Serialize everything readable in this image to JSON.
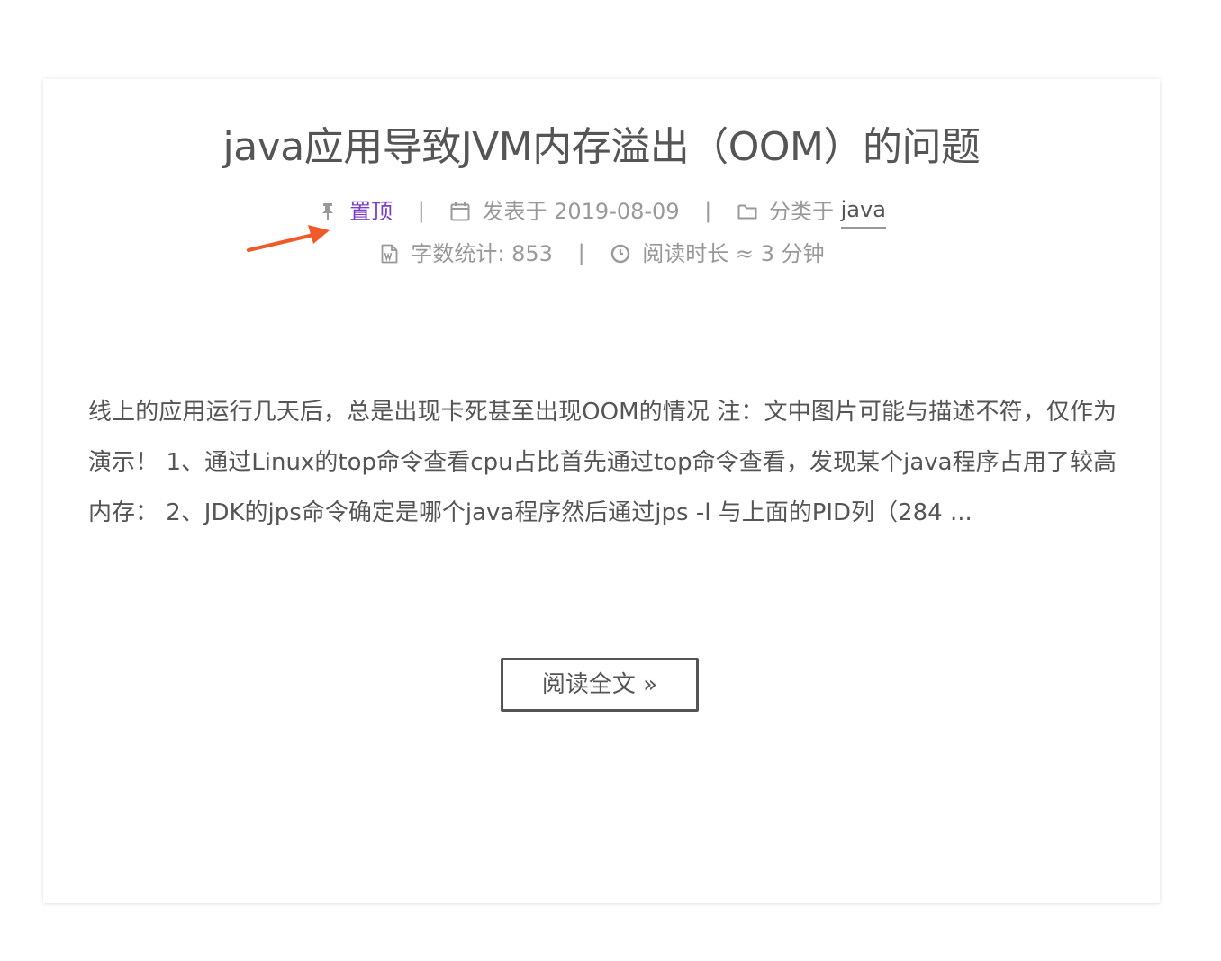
{
  "post": {
    "title": "java应用导致JVM内存溢出（OOM）的问题",
    "meta": {
      "pin_label": "置顶",
      "posted_prefix": "发表于",
      "posted_date": "2019-08-09",
      "category_prefix": "分类于",
      "category": "java",
      "wordcount_label": "字数统计:",
      "wordcount": "853",
      "readtime_label": "阅读时长 ≈",
      "readtime_value": "3",
      "readtime_unit": "分钟",
      "separator": "|"
    },
    "excerpt": "线上的应用运行几天后，总是出现卡死甚至出现OOM的情况 注：文中图片可能与描述不符，仅作为演示！ 1、通过Linux的top命令查看cpu占比首先通过top命令查看，发现某个java程序占用了较高内存： 2、JDK的jps命令确定是哪个java程序然后通过jps -l 与上面的PID列（284 ...",
    "read_more": "阅读全文 »"
  },
  "icons": {
    "pin": "thumbtack-icon",
    "date": "calendar-icon",
    "category": "folder-icon",
    "wordcount": "file-word-icon",
    "readtime": "clock-icon",
    "annotation": "arrow-icon"
  },
  "colors": {
    "text": "#555555",
    "meta": "#999999",
    "pin": "#7a3fc8",
    "annotation_arrow": "#f05a28"
  }
}
